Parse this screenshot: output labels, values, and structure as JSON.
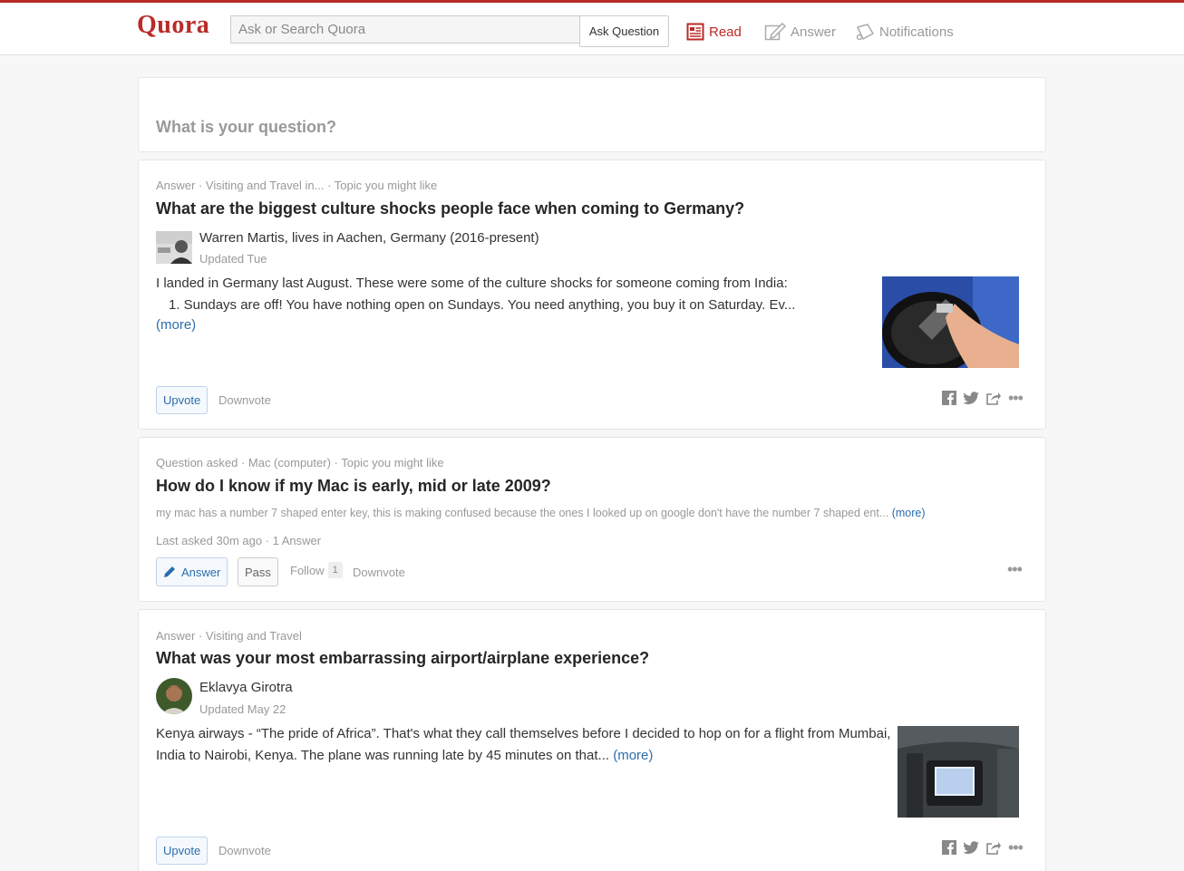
{
  "header": {
    "logo": "Quora",
    "search_placeholder": "Ask or Search Quora",
    "ask_button": "Ask Question",
    "nav": {
      "read": "Read",
      "answer": "Answer",
      "notifications": "Notifications"
    },
    "brand_color": "#b92b27"
  },
  "ask_card": {
    "prompt": "What is your question?"
  },
  "feed": [
    {
      "meta": "Answer · Visiting and Travel in... · Topic you might like",
      "title": "What are the biggest culture shocks people face when coming to Germany?",
      "author": "Warren Martis, lives in Aachen, Germany (2016-present)",
      "updated": "Updated Tue",
      "text_line1": "I landed in Germany last August. These were some of the culture shocks for someone coming from India:",
      "text_line2": "1. Sundays are off! You have nothing open on Sundays. You need anything, you buy it on Saturday. Ev...",
      "more": "(more)",
      "upvote": "Upvote",
      "downvote": "Downvote"
    },
    {
      "meta": "Question asked · Mac (computer) · Topic you might like",
      "title": "How do I know if my Mac is early, mid or late 2009?",
      "snippet": "my mac has a number 7 shaped enter key, this is making confused because the ones I looked up on google don't have the number 7 shaped ent...",
      "more": "(more)",
      "stats": "Last asked 30m ago · 1 Answer",
      "answer": "Answer",
      "pass": "Pass",
      "follow": "Follow",
      "follow_count": "1",
      "downvote": "Downvote"
    },
    {
      "meta": "Answer · Visiting and Travel",
      "title": "What was your most embarrassing airport/airplane experience?",
      "author": "Eklavya Girotra",
      "updated": "Updated May 22",
      "text_line1": "Kenya airways - “The pride of Africa”. That's what they call themselves before I decided to hop on for a flight from Mumbai,",
      "text_line2": "India to Nairobi, Kenya. The plane was running late by 45 minutes on that...",
      "more": "(more)",
      "upvote": "Upvote",
      "downvote": "Downvote"
    }
  ]
}
